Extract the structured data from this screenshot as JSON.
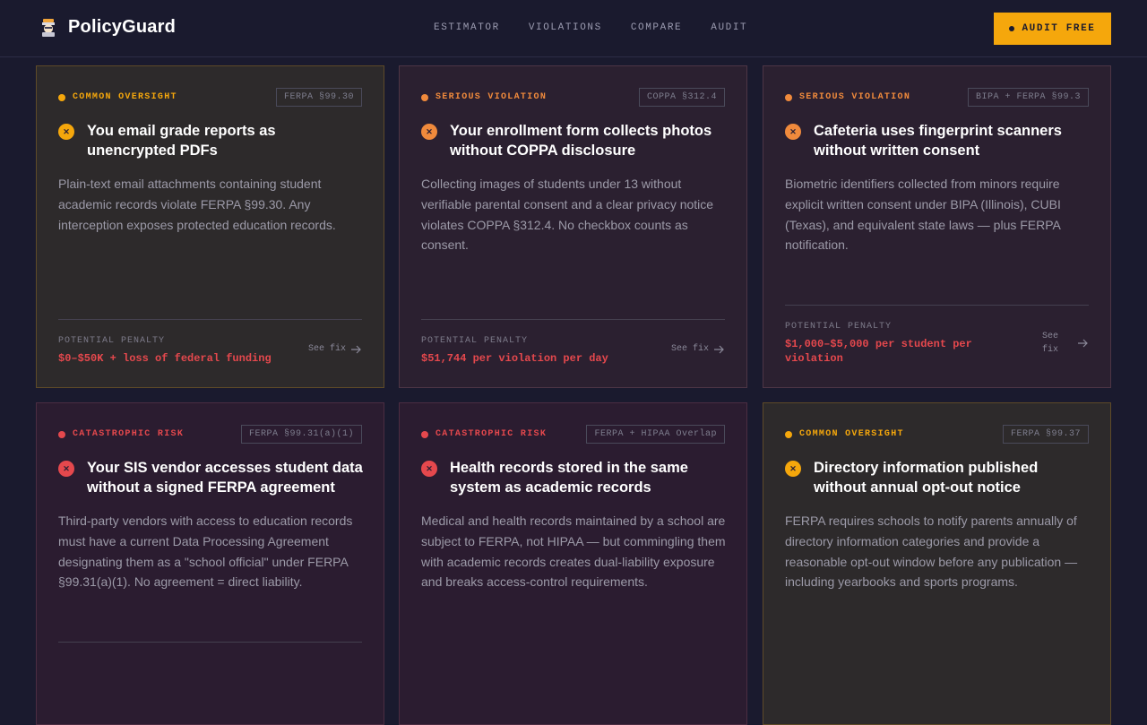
{
  "brand": {
    "name": "PolicyGuard",
    "icon": "shield-badge-icon"
  },
  "nav": {
    "links": [
      "ESTIMATOR",
      "VIOLATIONS",
      "COMPARE",
      "AUDIT"
    ],
    "cta": "AUDIT FREE"
  },
  "colors": {
    "background": "#1a1a2e",
    "accent": "#f5a70c",
    "common_oversight": "#f5a70c",
    "serious_violation": "#f08a3c",
    "catastrophic_risk": "#e5484d",
    "penalty_text": "#e5484d"
  },
  "penalty_label": "POTENTIAL PENALTY",
  "fix_label": "See fix",
  "cards": [
    {
      "severity": "COMMON OVERSIGHT",
      "ref": "FERPA §99.30",
      "title": "You email grade reports as unencrypted PDFs",
      "description": "Plain-text email attachments containing student academic records violate FERPA §99.30. Any interception exposes protected education records.",
      "penalty": "$0–$50K + loss of federal funding"
    },
    {
      "severity": "SERIOUS VIOLATION",
      "ref": "COPPA §312.4",
      "title": "Your enrollment form collects photos without COPPA disclosure",
      "description": "Collecting images of students under 13 without verifiable parental consent and a clear privacy notice violates COPPA §312.4. No checkbox counts as consent.",
      "penalty": "$51,744 per violation per day"
    },
    {
      "severity": "SERIOUS VIOLATION",
      "ref": "BIPA + FERPA §99.3",
      "title": "Cafeteria uses fingerprint scanners without written consent",
      "description": "Biometric identifiers collected from minors require explicit written consent under BIPA (Illinois), CUBI (Texas), and equivalent state laws — plus FERPA notification.",
      "penalty": "$1,000–$5,000 per student per violation"
    },
    {
      "severity": "CATASTROPHIC RISK",
      "ref": "FERPA §99.31(a)(1)",
      "title": "Your SIS vendor accesses student data without a signed FERPA agreement",
      "description": "Third-party vendors with access to education records must have a current Data Processing Agreement designating them as a \"school official\" under FERPA §99.31(a)(1). No agreement = direct liability."
    },
    {
      "severity": "CATASTROPHIC RISK",
      "ref": "FERPA + HIPAA Overlap",
      "title": "Health records stored in the same system as academic records",
      "description": "Medical and health records maintained by a school are subject to FERPA, not HIPAA — but commingling them with academic records creates dual-liability exposure and breaks access-control requirements."
    },
    {
      "severity": "COMMON OVERSIGHT",
      "ref": "FERPA §99.37",
      "title": "Directory information published without annual opt-out notice",
      "description": "FERPA requires schools to notify parents annually of directory information categories and provide a reasonable opt-out window before any publication — including yearbooks and sports programs."
    }
  ]
}
